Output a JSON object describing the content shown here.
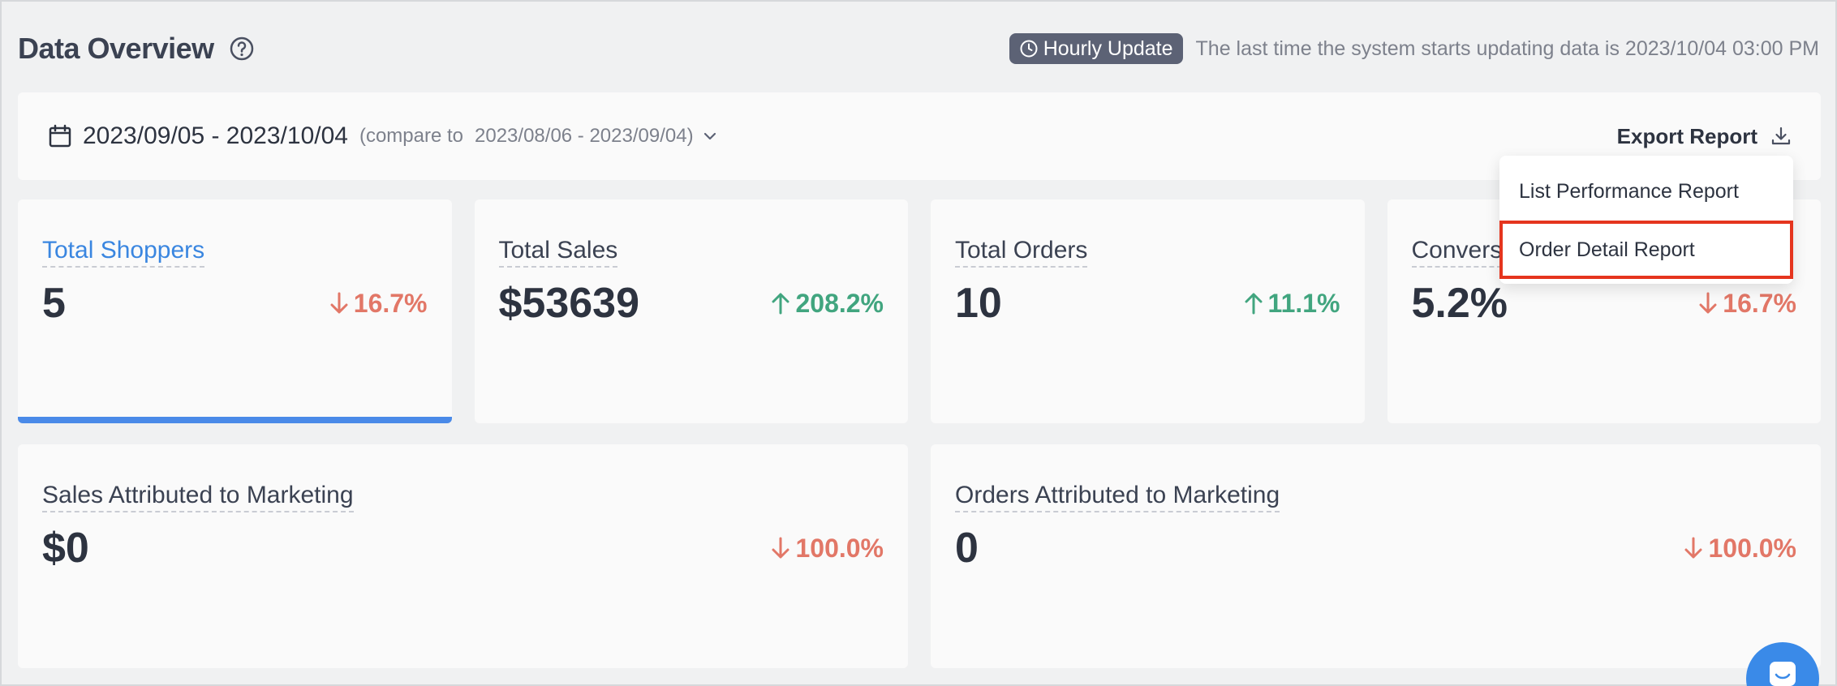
{
  "header": {
    "title": "Data Overview",
    "badge": "Hourly Update",
    "update_text": "The last time the system starts updating data is 2023/10/04 03:00 PM"
  },
  "date_bar": {
    "range": "2023/09/05 - 2023/10/04",
    "compare_label": "(compare to",
    "compare_range": "2023/08/06 - 2023/09/04)",
    "export_label": "Export Report"
  },
  "export_menu": {
    "items": [
      {
        "label": "List Performance Report"
      },
      {
        "label": "Order Detail Report"
      }
    ]
  },
  "cards": [
    {
      "label": "Total Shoppers",
      "value": "5",
      "delta": "16.7%",
      "direction": "down",
      "active": true
    },
    {
      "label": "Total Sales",
      "value": "$53639",
      "delta": "208.2%",
      "direction": "up"
    },
    {
      "label": "Total Orders",
      "value": "10",
      "delta": "11.1%",
      "direction": "up"
    },
    {
      "label": "Convers",
      "value": "5.2%",
      "delta": "16.7%",
      "direction": "down"
    }
  ],
  "cards_row2": [
    {
      "label": "Sales Attributed to Marketing",
      "value": "$0",
      "delta": "100.0%",
      "direction": "down"
    },
    {
      "label": "Orders Attributed to Marketing",
      "value": "0",
      "delta": "100.0%",
      "direction": "down"
    }
  ],
  "colors": {
    "accent": "#4a8ae8",
    "down": "#e27767",
    "up": "#41a57f",
    "highlight": "#e5351e"
  },
  "icons": {
    "help": "help-circle-icon",
    "clock": "clock-icon",
    "calendar": "calendar-icon",
    "chevron": "chevron-down-icon",
    "download": "download-icon",
    "chat": "chat-icon"
  }
}
